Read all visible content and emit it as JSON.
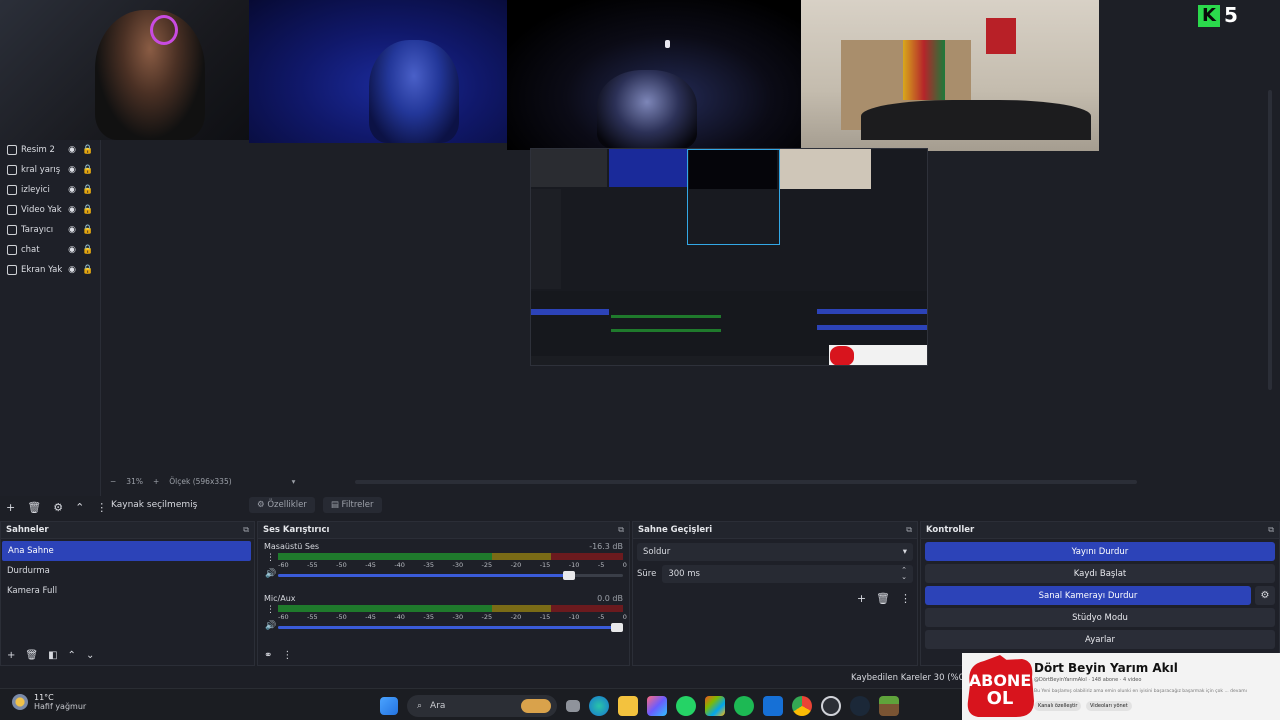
{
  "overlay": {
    "kick_logo": "K",
    "kick_count": "5"
  },
  "sources": [
    {
      "name": "Resim 2",
      "icon": "image-icon"
    },
    {
      "name": "kral yarış",
      "icon": "media-icon"
    },
    {
      "name": "izleyici",
      "icon": "media-icon"
    },
    {
      "name": "Video Yak",
      "icon": "camera-icon"
    },
    {
      "name": "Tarayıcı",
      "icon": "globe-icon"
    },
    {
      "name": "chat",
      "icon": "globe-icon"
    },
    {
      "name": "Ekran Yak",
      "icon": "monitor-icon"
    }
  ],
  "zoom": {
    "percent": "31%",
    "scale_label": "Ölçek (596x335)"
  },
  "selection": {
    "label": "Kaynak seçilmemiş",
    "properties": "Özellikler",
    "filters": "Filtreler"
  },
  "scenes": {
    "title": "Sahneler",
    "items": [
      "Ana Sahne",
      "Durdurma",
      "Kamera Full"
    ],
    "active_index": 0
  },
  "mixer": {
    "title": "Ses Karıştırıcı",
    "ticks": [
      "-60",
      "-55",
      "-50",
      "-45",
      "-40",
      "-35",
      "-30",
      "-25",
      "-20",
      "-15",
      "-10",
      "-5",
      "0"
    ],
    "channels": [
      {
        "name": "Masaüstü Ses",
        "db": "-16.3 dB",
        "level": 0.86
      },
      {
        "name": "Mic/Aux",
        "db": "0.0 dB",
        "level": 1.0
      }
    ]
  },
  "transitions": {
    "title": "Sahne Geçişleri",
    "selected": "Soldur",
    "duration_label": "Süre",
    "duration_value": "300 ms"
  },
  "controls": {
    "title": "Kontroller",
    "buttons": [
      "Yayını Durdur",
      "Kaydı Başlat",
      "Sanal Kamerayı Durdur",
      "Stüdyo Modu",
      "Ayarlar"
    ]
  },
  "status": {
    "dropped_frames": "Kaybedilen Kareler 30 (%0.0)"
  },
  "taskbar": {
    "temperature": "11°C",
    "weather": "Hafif yağmur",
    "search_placeholder": "Ara"
  },
  "abone": {
    "badge_top": "ABONE",
    "badge_bottom": "OL",
    "channel_title": "Dört Beyin Yarım Akıl",
    "handle": "@DörtBeyinYarımAkıl · 148 abone · 4 video",
    "description": "Bu Yeni başlamış olabiliriz ama emin olunki en iyisini başaracağız başarmak için çok ... devamı",
    "button_customize": "Kanalı özelleştir",
    "button_videos": "Videoları yönet"
  },
  "colors": {
    "accent": "#2c43b8",
    "panel": "#1e2028",
    "kick_green": "#2bd94c",
    "abone_red": "#d8141d"
  }
}
